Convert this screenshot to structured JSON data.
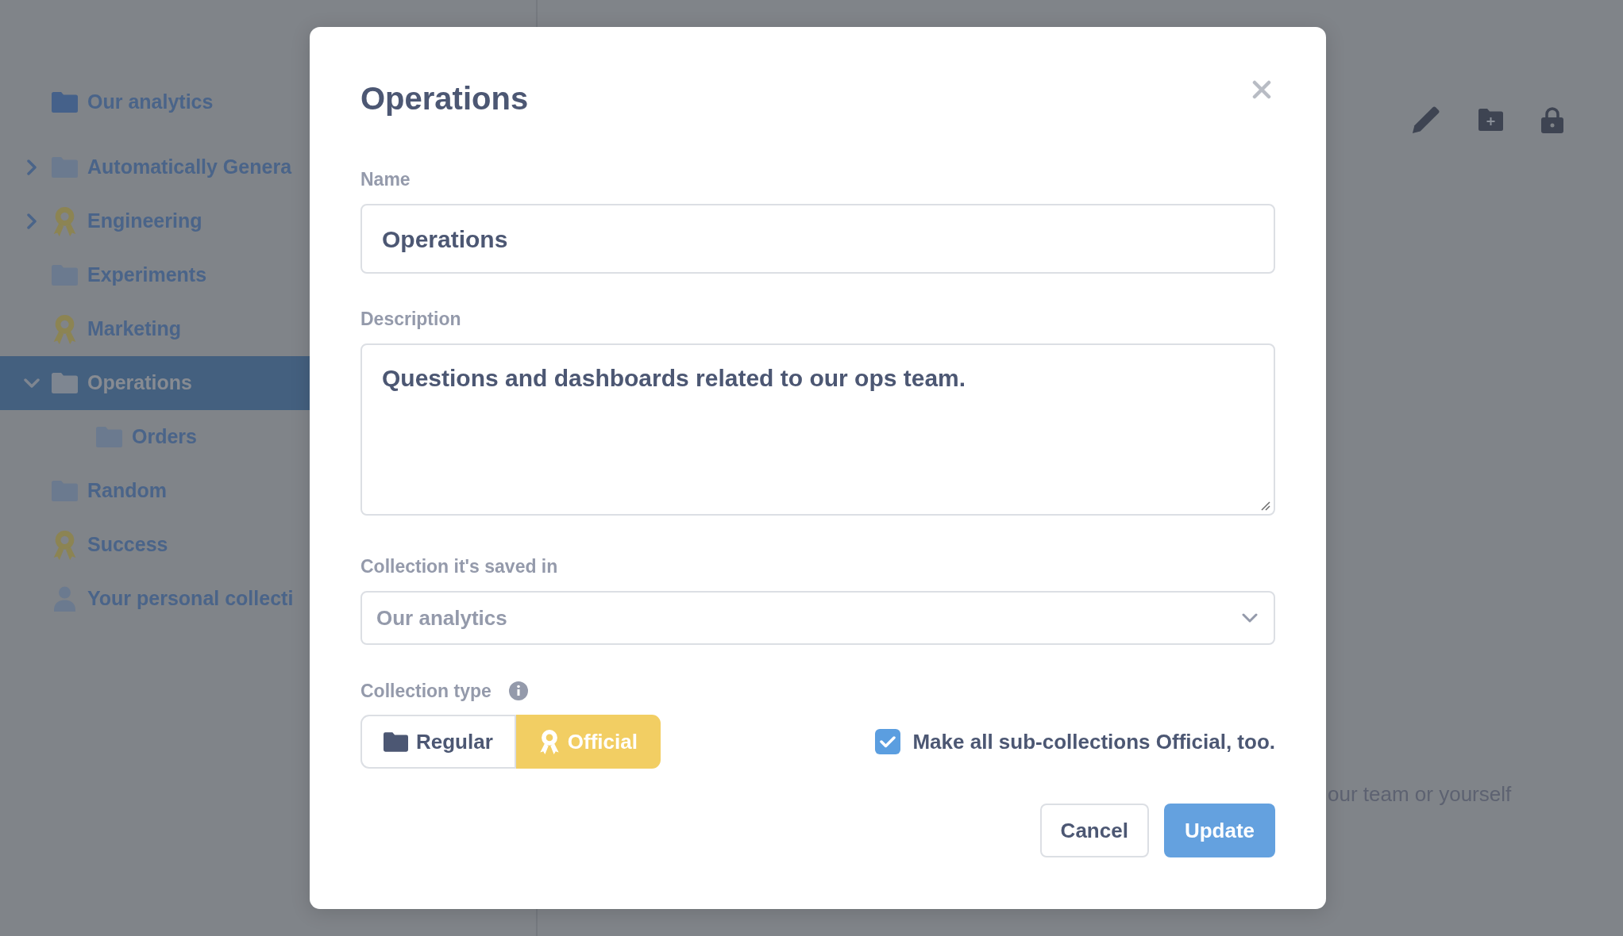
{
  "sidebar": {
    "items": [
      {
        "label": "Our analytics",
        "kind": "root",
        "selected": false
      },
      {
        "label": "Automatically Genera",
        "kind": "regular",
        "selected": false,
        "expanded": false
      },
      {
        "label": "Engineering",
        "kind": "official",
        "selected": false,
        "expanded": false
      },
      {
        "label": "Experiments",
        "kind": "regular",
        "selected": false
      },
      {
        "label": "Marketing",
        "kind": "official",
        "selected": false
      },
      {
        "label": "Operations",
        "kind": "regular",
        "selected": true,
        "expanded": true,
        "children": [
          {
            "label": "Orders",
            "kind": "regular",
            "selected": false
          }
        ]
      },
      {
        "label": "Random",
        "kind": "regular",
        "selected": false
      },
      {
        "label": "Success",
        "kind": "official",
        "selected": false
      },
      {
        "label": "Your personal collecti",
        "kind": "personal",
        "selected": false
      }
    ]
  },
  "main": {
    "hint": "our team or yourself"
  },
  "dialog": {
    "title": "Operations",
    "fields": [
      {
        "label": "Name",
        "kind": "text",
        "value": "Operations"
      },
      {
        "label": "Description",
        "kind": "textarea",
        "value": "Questions and dashboards related to our ops team."
      },
      {
        "label": "Collection it's saved in",
        "kind": "select",
        "value": "Our analytics"
      }
    ],
    "collection_type": {
      "label": "Collection type",
      "options": [
        {
          "label": "Regular",
          "kind": "regular",
          "selected": false
        },
        {
          "label": "Official",
          "kind": "official",
          "selected": true
        }
      ]
    },
    "subcollections": {
      "label": "Make all sub-collections Official, too.",
      "checked": true
    },
    "buttons": [
      {
        "label": "Cancel",
        "kind": "secondary"
      },
      {
        "label": "Update",
        "kind": "primary"
      }
    ]
  }
}
